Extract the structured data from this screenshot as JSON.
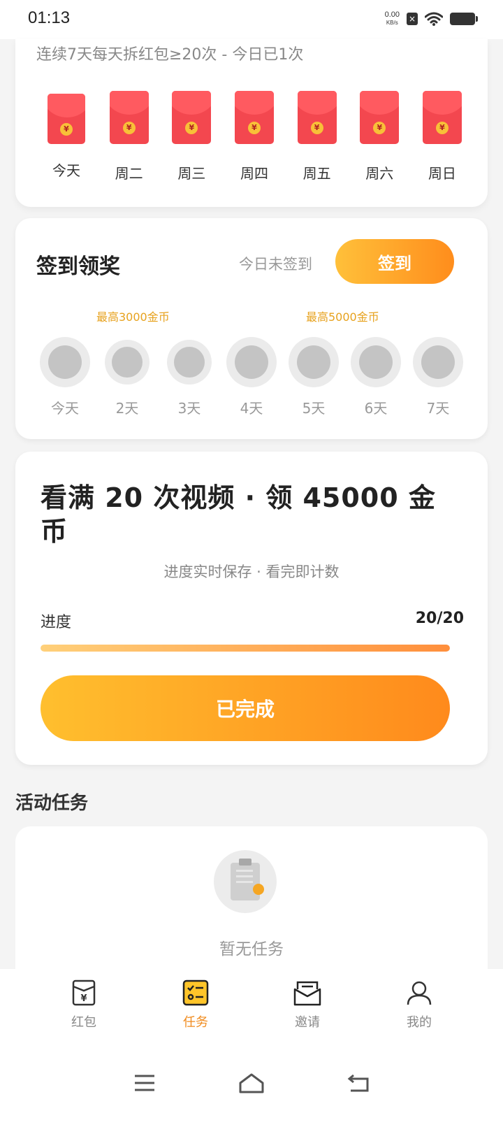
{
  "status_bar": {
    "time": "01:13",
    "net_speed": "0.00",
    "net_unit": "KB/s",
    "sim_icon": "sim-off-icon",
    "wifi_icon": "wifi-icon",
    "battery_icon": "battery-icon"
  },
  "red_packet": {
    "header": "连续7天每天拆红包≥20次 - 今日已1次",
    "coin_symbol": "¥",
    "days": [
      {
        "label": "今天"
      },
      {
        "label": "周二"
      },
      {
        "label": "周三"
      },
      {
        "label": "周四"
      },
      {
        "label": "周五"
      },
      {
        "label": "周六"
      },
      {
        "label": "周日"
      }
    ]
  },
  "checkin": {
    "title": "签到领奖",
    "status": "今日未签到",
    "button_label": "签到",
    "hint_1": "最高3000金币",
    "hint_2": "最高5000金币",
    "days": [
      {
        "label": "今天"
      },
      {
        "label": "2天"
      },
      {
        "label": "3天"
      },
      {
        "label": "4天"
      },
      {
        "label": "5天"
      },
      {
        "label": "6天"
      },
      {
        "label": "7天"
      }
    ]
  },
  "video_task": {
    "title": "看满 20 次视频 · 领 45000 金币",
    "subtitle": "进度实时保存 · 看完即计数",
    "progress_label": "进度",
    "progress_value": "20/20",
    "progress_fraction": 1.0,
    "button_label": "已完成"
  },
  "activity": {
    "title": "活动任务",
    "empty_text": "暂无任务"
  },
  "bottom_nav": {
    "items": [
      {
        "label": "红包",
        "icon": "red-packet-icon",
        "active": false
      },
      {
        "label": "任务",
        "icon": "task-list-icon",
        "active": true
      },
      {
        "label": "邀请",
        "icon": "invite-envelope-icon",
        "active": false
      },
      {
        "label": "我的",
        "icon": "profile-icon",
        "active": false
      }
    ]
  },
  "colors": {
    "accent_orange": "#ff8a1c",
    "accent_yellow": "#ffbf2e",
    "packet_red": "#f3474f",
    "nav_active": "#f08b1e"
  }
}
